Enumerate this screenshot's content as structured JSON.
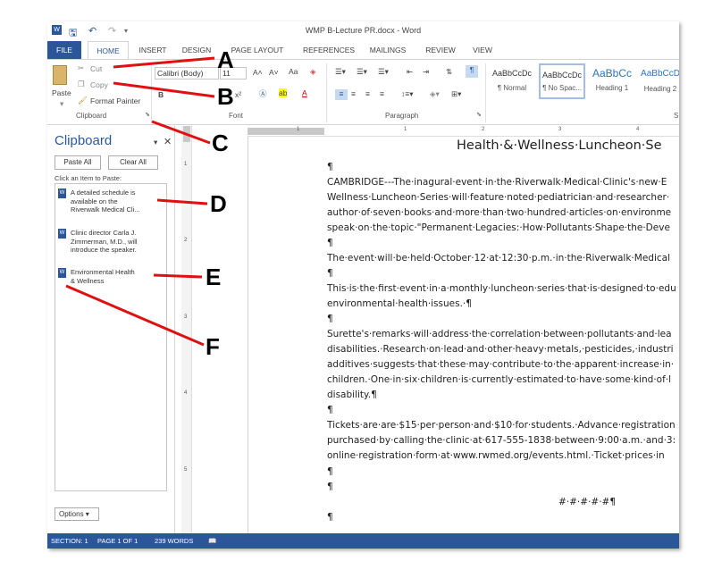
{
  "window": {
    "title": "WMP B-Lecture PR.docx - Word"
  },
  "quick_access": {
    "undo_glyph": "↶",
    "redo_glyph": "↷",
    "save_icon": "save-icon"
  },
  "tabs": [
    "FILE",
    "HOME",
    "INSERT",
    "DESIGN",
    "PAGE LAYOUT",
    "REFERENCES",
    "MAILINGS",
    "REVIEW",
    "VIEW"
  ],
  "ribbon": {
    "clipboard": {
      "paste": "Paste",
      "cut": "Cut",
      "copy": "Copy",
      "format_painter": "Format Painter",
      "label": "Clipboard"
    },
    "font": {
      "name": "Calibri (Body)",
      "size": "11",
      "label": "Font",
      "sample_aa": "Aa",
      "bold": "B",
      "superscript": "x²"
    },
    "paragraph": {
      "label": "Paragraph"
    },
    "styles": [
      {
        "sample": "AaBbCcDc",
        "name": "¶ Normal"
      },
      {
        "sample": "AaBbCcDc",
        "name": "¶ No Spac..."
      },
      {
        "sample": "AaBbCc",
        "name": "Heading 1"
      },
      {
        "sample": "AaBbCcD",
        "name": "Heading 2"
      }
    ],
    "styles_label": "S"
  },
  "clipboard_pane": {
    "title": "Clipboard",
    "paste_all": "Paste All",
    "clear_all": "Clear All",
    "hint": "Click an Item to Paste:",
    "items": [
      {
        "line1": "A detailed schedule is",
        "line2": "available on the",
        "line3": "Riverwalk Medical Cli..."
      },
      {
        "line1": "Clinic director Carla J.",
        "line2": "Zimmerman, M.D., will",
        "line3": "introduce the speaker."
      },
      {
        "line1": "Environmental Health",
        "line2": "& Wellness",
        "line3": ""
      }
    ],
    "options": "Options ▾"
  },
  "document": {
    "title": "Health·&·Wellness·Luncheon·Se",
    "lines": [
      "¶",
      "CAMBRIDGE---The·inagural·event·in·the·Riverwalk·Medical·Clinic's·new·E",
      "Wellness·Luncheon·Series·will·feature·noted·pediatrician·and·researcher·",
      "author·of·seven·books·and·more·than·two·hundred·articles·on·environme",
      "speak·on·the·topic·\"Permanent·Legacies:·How·Pollutants·Shape·the·Deve",
      "¶",
      "The·event·will·be·held·October·12·at·12:30·p.m.·in·the·Riverwalk·Medical",
      "¶",
      "This·is·the·first·event·in·a·monthly·luncheon·series·that·is·designed·to·edu",
      "environmental·health·issues.·¶",
      "¶",
      "Surette's·remarks·will·address·the·correlation·between·pollutants·and·lea",
      "disabilities.·Research·on·lead·and·other·heavy·metals,·pesticides,·industri",
      "additives·suggests·that·these·may·contribute·to·the·apparent·increase·in·",
      "children.·One·in·six·children·is·currently·estimated·to·have·some·kind·of·l",
      "disability.¶",
      "¶",
      "Tickets·are·are·$15·per·person·and·$10·for·students.·Advance·registration",
      "purchased·by·calling·the·clinic·at·617-555-1838·between·9:00·a.m.·and·3:",
      "online·registration·form·at·www.rwmed.org/events.html.·Ticket·prices·in",
      "¶",
      "¶",
      "#·#·#·#·#¶",
      "¶"
    ]
  },
  "status_bar": {
    "section": "SECTION: 1",
    "page": "PAGE 1 OF 1",
    "words": "239 WORDS"
  },
  "annotations": [
    "A",
    "B",
    "C",
    "D",
    "E",
    "F"
  ],
  "colors": {
    "accent": "#2b579a",
    "annotation_line": "#e01010"
  }
}
